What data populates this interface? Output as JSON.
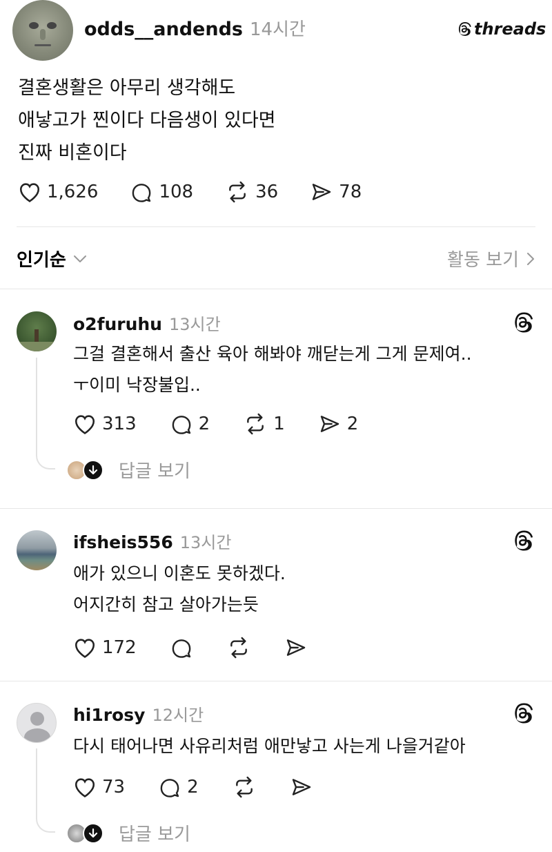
{
  "post": {
    "username": "odds__andends",
    "time": "14시간",
    "brand": "threads",
    "lines": [
      "결혼생활은 아무리 생각해도",
      "애낳고가 찐이다 다음생이 있다면",
      "진짜 비혼이다"
    ],
    "likes": "1,626",
    "comments": "108",
    "reposts": "36",
    "shares": "78"
  },
  "sort": {
    "label": "인기순",
    "activity": "활동 보기"
  },
  "comments": [
    {
      "username": "o2furuhu",
      "time": "13시간",
      "lines": [
        "그걸 결혼해서 출산 육아 해봐야 깨닫는게 그게 문제여..",
        "ㅜ이미 낙장불입.."
      ],
      "likes": "313",
      "comments": "2",
      "reposts": "1",
      "shares": "2",
      "reply_link": "답글 보기"
    },
    {
      "username": "ifsheis556",
      "time": "13시간",
      "lines": [
        "애가 있으니 이혼도 못하겠다.",
        "어지간히 참고 살아가는듯"
      ],
      "likes": "172"
    },
    {
      "username": "hi1rosy",
      "time": "12시간",
      "lines": [
        "다시 태어나면 사유리처럼 애만낳고 사는게 나을거같아"
      ],
      "likes": "73",
      "comments": "2",
      "reply_link": "답글 보기"
    }
  ],
  "icons": {
    "like": "heart-icon",
    "comment": "comment-bubble-icon",
    "repost": "repost-icon",
    "share": "send-icon",
    "threads": "threads-logo-icon",
    "chevron": "chevron-down-icon",
    "arrow": "chevron-right-icon"
  }
}
